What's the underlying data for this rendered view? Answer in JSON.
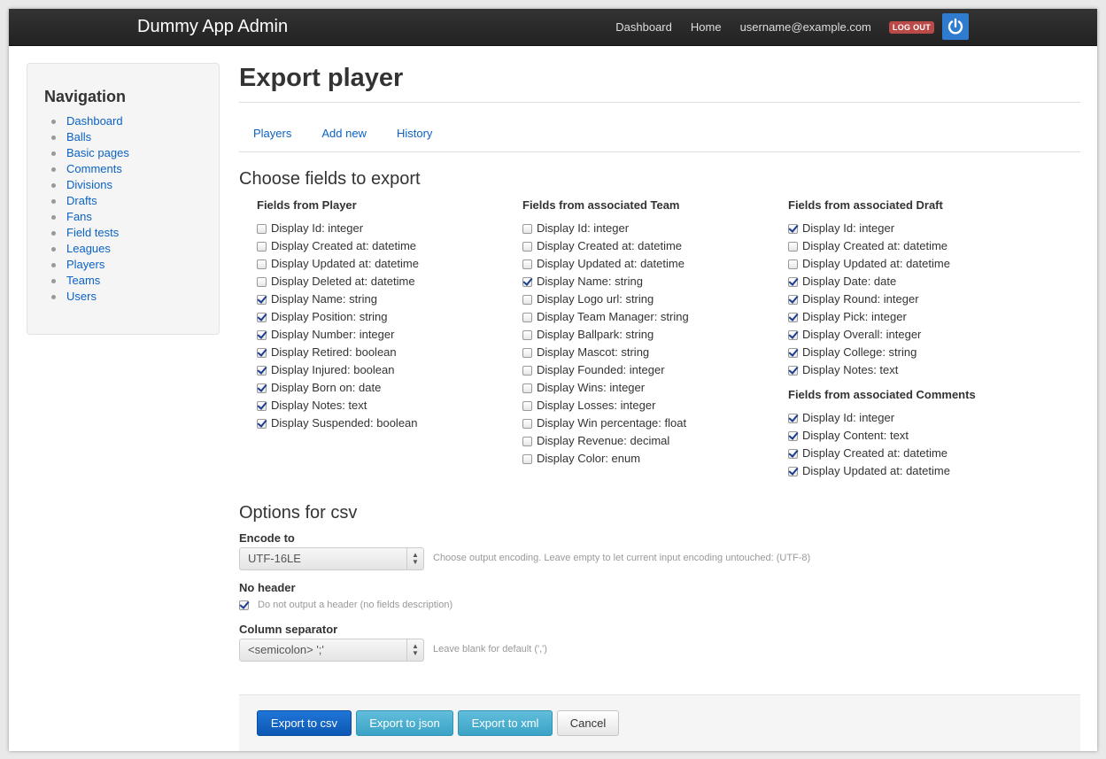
{
  "app": {
    "brand": "Dummy App Admin",
    "nav": [
      "Dashboard",
      "Home",
      "username@example.com"
    ],
    "logout": "LOG OUT"
  },
  "sidebar": {
    "title": "Navigation",
    "items": [
      "Dashboard",
      "Balls",
      "Basic pages",
      "Comments",
      "Divisions",
      "Drafts",
      "Fans",
      "Field tests",
      "Leagues",
      "Players",
      "Teams",
      "Users"
    ]
  },
  "page": {
    "title": "Export player",
    "tabs": [
      "Players",
      "Add new",
      "History"
    ]
  },
  "fields_section": {
    "title": "Choose fields to export",
    "columns": [
      {
        "groups": [
          {
            "heading": "Fields from Player",
            "fields": [
              {
                "label": "Display Id: integer",
                "checked": false
              },
              {
                "label": "Display Created at: datetime",
                "checked": false
              },
              {
                "label": "Display Updated at: datetime",
                "checked": false
              },
              {
                "label": "Display Deleted at: datetime",
                "checked": false
              },
              {
                "label": "Display Name: string",
                "checked": true
              },
              {
                "label": "Display Position: string",
                "checked": true
              },
              {
                "label": "Display Number: integer",
                "checked": true
              },
              {
                "label": "Display Retired: boolean",
                "checked": true
              },
              {
                "label": "Display Injured: boolean",
                "checked": true
              },
              {
                "label": "Display Born on: date",
                "checked": true
              },
              {
                "label": "Display Notes: text",
                "checked": true
              },
              {
                "label": "Display Suspended: boolean",
                "checked": true
              }
            ]
          }
        ]
      },
      {
        "groups": [
          {
            "heading": "Fields from associated Team",
            "fields": [
              {
                "label": "Display Id: integer",
                "checked": false
              },
              {
                "label": "Display Created at: datetime",
                "checked": false
              },
              {
                "label": "Display Updated at: datetime",
                "checked": false
              },
              {
                "label": "Display Name: string",
                "checked": true
              },
              {
                "label": "Display Logo url: string",
                "checked": false
              },
              {
                "label": "Display Team Manager: string",
                "checked": false
              },
              {
                "label": "Display Ballpark: string",
                "checked": false
              },
              {
                "label": "Display Mascot: string",
                "checked": false
              },
              {
                "label": "Display Founded: integer",
                "checked": false
              },
              {
                "label": "Display Wins: integer",
                "checked": false
              },
              {
                "label": "Display Losses: integer",
                "checked": false
              },
              {
                "label": "Display Win percentage: float",
                "checked": false
              },
              {
                "label": "Display Revenue: decimal",
                "checked": false
              },
              {
                "label": "Display Color: enum",
                "checked": false
              }
            ]
          }
        ]
      },
      {
        "groups": [
          {
            "heading": "Fields from associated Draft",
            "fields": [
              {
                "label": "Display Id: integer",
                "checked": true
              },
              {
                "label": "Display Created at: datetime",
                "checked": false
              },
              {
                "label": "Display Updated at: datetime",
                "checked": false
              },
              {
                "label": "Display Date: date",
                "checked": true
              },
              {
                "label": "Display Round: integer",
                "checked": true
              },
              {
                "label": "Display Pick: integer",
                "checked": true
              },
              {
                "label": "Display Overall: integer",
                "checked": true
              },
              {
                "label": "Display College: string",
                "checked": true
              },
              {
                "label": "Display Notes: text",
                "checked": true
              }
            ]
          },
          {
            "heading": "Fields from associated Comments",
            "fields": [
              {
                "label": "Display Id: integer",
                "checked": true
              },
              {
                "label": "Display Content: text",
                "checked": true
              },
              {
                "label": "Display Created at: datetime",
                "checked": true
              },
              {
                "label": "Display Updated at: datetime",
                "checked": true
              }
            ]
          }
        ]
      }
    ]
  },
  "csv_options": {
    "title": "Options for csv",
    "encode_label": "Encode to",
    "encode_value": "UTF-16LE",
    "encode_help": "Choose output encoding. Leave empty to let current input encoding untouched: (UTF-8)",
    "no_header_label": "No header",
    "no_header_checked": true,
    "no_header_help": "Do not output a header (no fields description)",
    "separator_label": "Column separator",
    "separator_value": "<semicolon> ';'",
    "separator_help": "Leave blank for default (',')"
  },
  "actions": {
    "csv": "Export to csv",
    "json": "Export to json",
    "xml": "Export to xml",
    "cancel": "Cancel"
  }
}
